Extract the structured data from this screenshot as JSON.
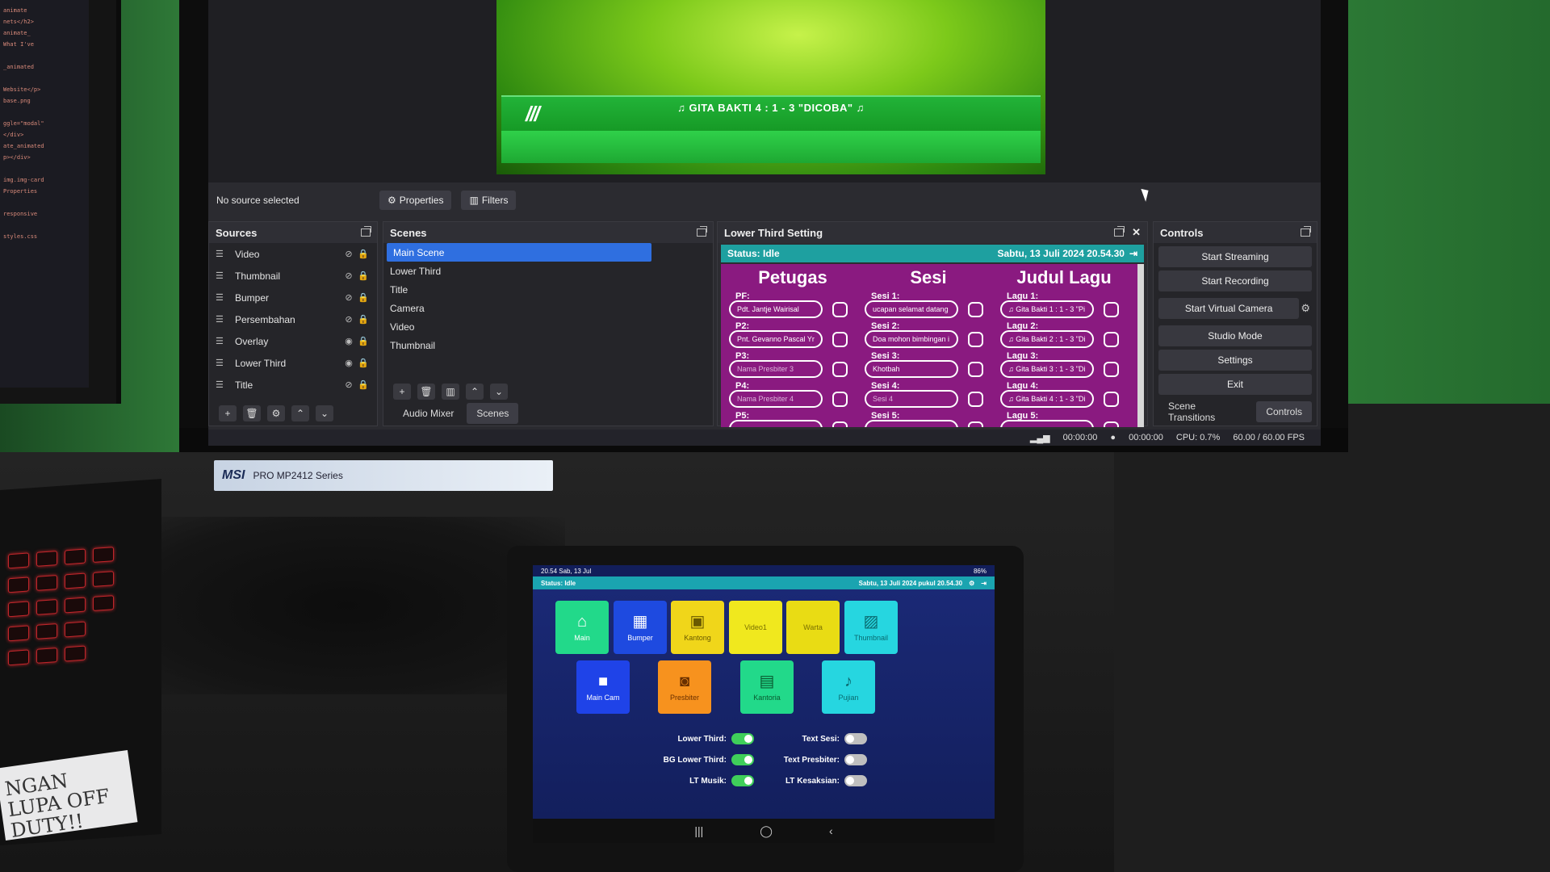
{
  "obs": {
    "preview": {
      "lower_third_text": "♫ GITA BAKTI 4 : 1 - 3 \"DICOBA\" ♫",
      "stripe": "///"
    },
    "toolbar": {
      "no_source": "No source selected",
      "properties": "Properties",
      "filters": "Filters"
    },
    "sources": {
      "title": "Sources",
      "items": [
        {
          "label": "Video",
          "visible": false
        },
        {
          "label": "Thumbnail",
          "visible": false
        },
        {
          "label": "Bumper",
          "visible": false
        },
        {
          "label": "Persembahan",
          "visible": false
        },
        {
          "label": "Overlay",
          "visible": true
        },
        {
          "label": "Lower Third",
          "visible": true
        },
        {
          "label": "Title",
          "visible": false
        }
      ]
    },
    "scenes": {
      "title": "Scenes",
      "items": [
        "Main Scene",
        "Lower Third",
        "Title",
        "Camera",
        "Video",
        "Thumbnail"
      ],
      "tabs": [
        "Audio Mixer",
        "Scenes"
      ]
    },
    "lower_third": {
      "title": "Lower Third Setting",
      "status": "Status: Idle",
      "datetime": "Sabtu, 13 Juli 2024 20.54.30",
      "col_petugas": "Petugas",
      "col_sesi": "Sesi",
      "col_lagu": "Judul Lagu",
      "petugas": [
        {
          "label": "PF:",
          "value": "Pdt. Jantje Wairisal",
          "placeholder": false
        },
        {
          "label": "P2:",
          "value": "Pnt. Gevanno Pascal Yr",
          "placeholder": false
        },
        {
          "label": "P3:",
          "value": "Nama Presbiter 3",
          "placeholder": true
        },
        {
          "label": "P4:",
          "value": "Nama Presbiter 4",
          "placeholder": true
        },
        {
          "label": "P5:",
          "value": "",
          "placeholder": true
        }
      ],
      "sesi": [
        {
          "label": "Sesi 1:",
          "value": "ucapan selamat datang",
          "placeholder": false
        },
        {
          "label": "Sesi 2:",
          "value": "Doa mohon bimbingan i",
          "placeholder": false
        },
        {
          "label": "Sesi 3:",
          "value": "Khotbah",
          "placeholder": false
        },
        {
          "label": "Sesi 4:",
          "value": "Sesi 4",
          "placeholder": true
        },
        {
          "label": "Sesi 5:",
          "value": "",
          "placeholder": true
        }
      ],
      "lagu": [
        {
          "label": "Lagu 1:",
          "value": "♫ Gita Bakti 1 : 1 - 3 \"Pi",
          "placeholder": false
        },
        {
          "label": "Lagu 2:",
          "value": "♫ Gita Bakti 2 : 1 - 3 \"Di",
          "placeholder": false
        },
        {
          "label": "Lagu 3:",
          "value": "♫ Gita Bakti 3 : 1 - 3 \"Di",
          "placeholder": false
        },
        {
          "label": "Lagu 4:",
          "value": "♫ Gita Bakti 4 : 1 - 3 \"Di",
          "placeholder": false
        },
        {
          "label": "Lagu 5:",
          "value": "",
          "placeholder": true
        }
      ]
    },
    "controls": {
      "title": "Controls",
      "start_streaming": "Start Streaming",
      "start_recording": "Start Recording",
      "start_virtual_camera": "Start Virtual Camera",
      "studio_mode": "Studio Mode",
      "settings": "Settings",
      "exit": "Exit",
      "tabs": [
        "Scene Transitions",
        "Controls"
      ]
    },
    "status": {
      "stream_time": "00:00:00",
      "rec_time": "00:00:00",
      "cpu": "CPU: 0.7%",
      "fps": "60.00 / 60.00 FPS"
    }
  },
  "monitor_label": {
    "brand": "MSI",
    "model": "PRO MP2412 Series"
  },
  "tablet": {
    "statusbar_left": "20.54  Sab, 13 Jul",
    "statusbar_right": "86%",
    "status": "Status: Idle",
    "datetime": "Sabtu, 13 Juli 2024 pukul 20.54.30",
    "buttons_row1": [
      {
        "label": "Main",
        "icon": "home-icon",
        "bg": "#22d98a",
        "fg": "#ffffff"
      },
      {
        "label": "Bumper",
        "icon": "film-icon",
        "bg": "#1e4ae0",
        "fg": "#ffffff"
      },
      {
        "label": "Kantong",
        "icon": "qr-icon",
        "bg": "#f0d61a",
        "fg": "#6a5a00"
      },
      {
        "label": "Video1",
        "icon": "",
        "bg": "#f0e81e",
        "fg": "#7a7000"
      },
      {
        "label": "Warta",
        "icon": "",
        "bg": "#e9dc14",
        "fg": "#7a7000"
      },
      {
        "label": "Thumbnail",
        "icon": "image-icon",
        "bg": "#26d6e0",
        "fg": "#0a6a70"
      }
    ],
    "buttons_row2": [
      {
        "label": "Main Cam",
        "icon": "video-camera-icon",
        "bg": "#1f43e8",
        "fg": "#ffffff"
      },
      {
        "label": "Presbiter",
        "icon": "camera-icon",
        "bg": "#f7921e",
        "fg": "#6a3000"
      },
      {
        "label": "Kantoria",
        "icon": "radio-icon",
        "bg": "#22d98a",
        "fg": "#0a5a30"
      },
      {
        "label": "Pujian",
        "icon": "guitar-icon",
        "bg": "#26d6e0",
        "fg": "#0a6a70"
      }
    ],
    "toggles_left": [
      {
        "label": "Lower Third:",
        "on": true
      },
      {
        "label": "BG Lower Third:",
        "on": true
      },
      {
        "label": "LT Musik:",
        "on": true
      }
    ],
    "toggles_right": [
      {
        "label": "Text Sesi:",
        "on": false
      },
      {
        "label": "Text Presbiter:",
        "on": false
      },
      {
        "label": "LT Kesaksian:",
        "on": false
      }
    ]
  },
  "sticky_note": "NGAN LUPA OFF DUTY!!"
}
